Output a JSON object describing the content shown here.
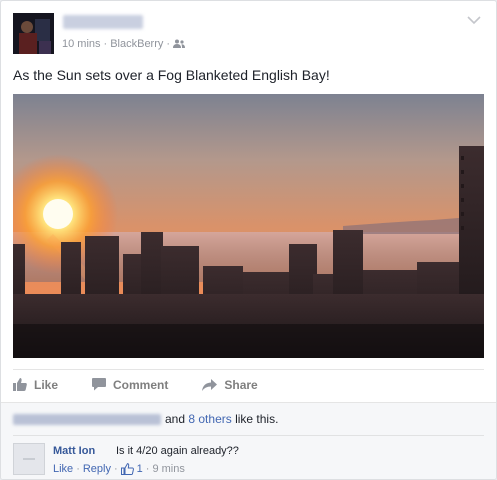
{
  "post": {
    "time": "10 mins",
    "source": "BlackBerry",
    "separator": "·",
    "text": "As the Sun sets over a Fog Blanketed English Bay!",
    "privacy_icon": "friends-icon",
    "menu_icon": "chevron-down-icon"
  },
  "actions": {
    "like": "Like",
    "comment": "Comment",
    "share": "Share"
  },
  "likes": {
    "connector": "and",
    "others_link": "8 others",
    "suffix": "like this."
  },
  "comment": {
    "author": "Matt Ion",
    "text": "Is it 4/20 again already??",
    "like_link": "Like",
    "reply_link": "Reply",
    "like_count": "1",
    "time": "9 mins",
    "separator": "·"
  },
  "colors": {
    "link": "#4267b2",
    "author": "#365899",
    "muted": "#90949c"
  }
}
